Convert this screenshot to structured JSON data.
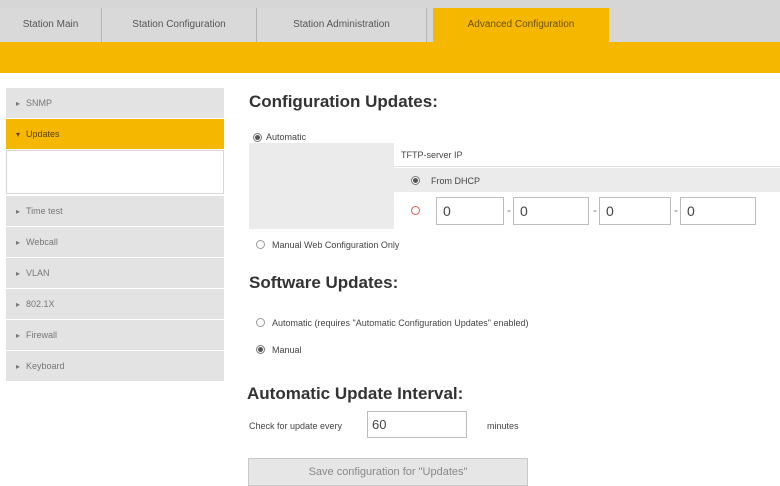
{
  "tabs": [
    {
      "label": "Station Main"
    },
    {
      "label": "Station Configuration"
    },
    {
      "label": "Station Administration"
    },
    {
      "label": "Advanced Configuration",
      "active": true
    }
  ],
  "sidebar": {
    "items": [
      {
        "label": "SNMP",
        "expanded": false
      },
      {
        "label": "Updates",
        "expanded": true
      },
      {
        "label": "Time test",
        "expanded": false
      },
      {
        "label": "Webcall",
        "expanded": false
      },
      {
        "label": "VLAN",
        "expanded": false
      },
      {
        "label": "802.1X",
        "expanded": false
      },
      {
        "label": "Firewall",
        "expanded": false
      },
      {
        "label": "Keyboard",
        "expanded": false
      }
    ]
  },
  "config_updates": {
    "title": "Configuration Updates:",
    "automatic_label": "Automatic",
    "tftp_label": "TFTP-server IP",
    "from_dhcp_label": "From DHCP",
    "ip": [
      "0",
      "0",
      "0",
      "0"
    ],
    "ip_separator": "-",
    "manual_web_label": "Manual Web Configuration Only"
  },
  "software_updates": {
    "title": "Software Updates:",
    "automatic_label": "Automatic (requires \"Automatic Configuration Updates\" enabled)",
    "manual_label": "Manual"
  },
  "interval": {
    "title": "Automatic Update Interval:",
    "prefix": "Check for update every",
    "value": "60",
    "unit": "minutes"
  },
  "save_button_label": "Save configuration for \"Updates\"",
  "colors": {
    "accent": "#f5b700",
    "tab_bg": "#d9d9d9",
    "sidebar_bg": "#e3e3e3"
  }
}
